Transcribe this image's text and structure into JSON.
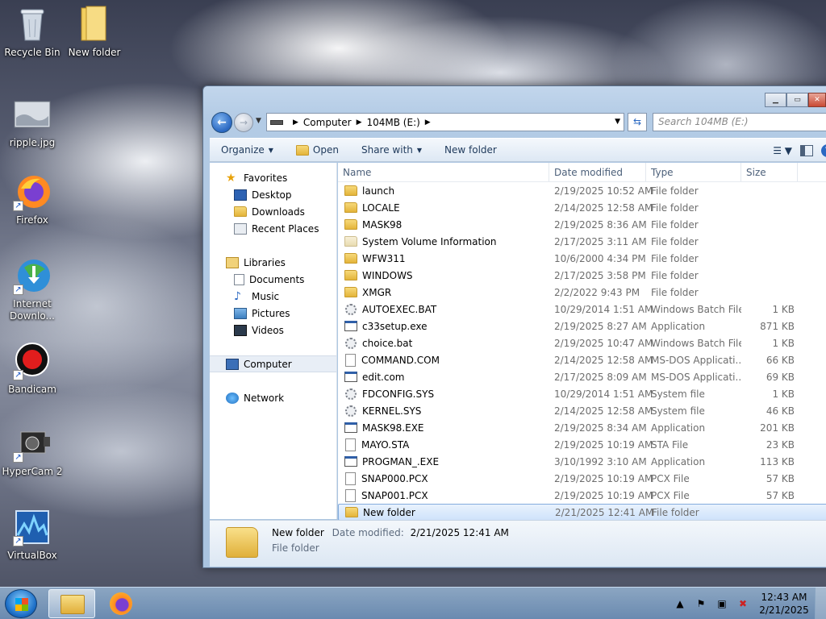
{
  "desktop": {
    "icons": [
      {
        "label": "Recycle Bin"
      },
      {
        "label": "New folder"
      },
      {
        "label": "ripple.jpg"
      },
      {
        "label": "Firefox"
      },
      {
        "label": "Internet Downlo..."
      },
      {
        "label": "Bandicam"
      },
      {
        "label": "HyperCam 2"
      },
      {
        "label": "VirtualBox"
      }
    ]
  },
  "window": {
    "address": {
      "crumbs": [
        "Computer",
        "104MB (E:)"
      ]
    },
    "search_placeholder": "Search 104MB (E:)",
    "toolbar": {
      "organize": "Organize",
      "open": "Open",
      "share_with": "Share with",
      "new_folder": "New folder"
    },
    "nav": {
      "favorites": "Favorites",
      "desktop": "Desktop",
      "downloads": "Downloads",
      "recent_places": "Recent Places",
      "libraries": "Libraries",
      "documents": "Documents",
      "music": "Music",
      "pictures": "Pictures",
      "videos": "Videos",
      "computer": "Computer",
      "network": "Network"
    },
    "columns": {
      "name": "Name",
      "date_modified": "Date modified",
      "type": "Type",
      "size": "Size"
    },
    "files": [
      {
        "name": "launch",
        "date": "2/19/2025 10:52 AM",
        "type": "File folder",
        "size": "",
        "icon": "folder"
      },
      {
        "name": "LOCALE",
        "date": "2/14/2025 12:58 AM",
        "type": "File folder",
        "size": "",
        "icon": "folder"
      },
      {
        "name": "MASK98",
        "date": "2/19/2025 8:36 AM",
        "type": "File folder",
        "size": "",
        "icon": "folder"
      },
      {
        "name": "System Volume Information",
        "date": "2/17/2025 3:11 AM",
        "type": "File folder",
        "size": "",
        "icon": "folder-system"
      },
      {
        "name": "WFW311",
        "date": "10/6/2000 4:34 PM",
        "type": "File folder",
        "size": "",
        "icon": "folder"
      },
      {
        "name": "WINDOWS",
        "date": "2/17/2025 3:58 PM",
        "type": "File folder",
        "size": "",
        "icon": "folder"
      },
      {
        "name": "XMGR",
        "date": "2/2/2022 9:43 PM",
        "type": "File folder",
        "size": "",
        "icon": "folder"
      },
      {
        "name": "AUTOEXEC.BAT",
        "date": "10/29/2014 1:51 AM",
        "type": "Windows Batch File",
        "size": "1 KB",
        "icon": "gear"
      },
      {
        "name": "c33setup.exe",
        "date": "2/19/2025 8:27 AM",
        "type": "Application",
        "size": "871 KB",
        "icon": "app"
      },
      {
        "name": "choice.bat",
        "date": "2/19/2025 10:47 AM",
        "type": "Windows Batch File",
        "size": "1 KB",
        "icon": "gear"
      },
      {
        "name": "COMMAND.COM",
        "date": "2/14/2025 12:58 AM",
        "type": "MS-DOS Applicati...",
        "size": "66 KB",
        "icon": "doc"
      },
      {
        "name": "edit.com",
        "date": "2/17/2025 8:09 AM",
        "type": "MS-DOS Applicati...",
        "size": "69 KB",
        "icon": "app"
      },
      {
        "name": "FDCONFIG.SYS",
        "date": "10/29/2014 1:51 AM",
        "type": "System file",
        "size": "1 KB",
        "icon": "gear"
      },
      {
        "name": "KERNEL.SYS",
        "date": "2/14/2025 12:58 AM",
        "type": "System file",
        "size": "46 KB",
        "icon": "gear"
      },
      {
        "name": "MASK98.EXE",
        "date": "2/19/2025 8:34 AM",
        "type": "Application",
        "size": "201 KB",
        "icon": "app"
      },
      {
        "name": "MAYO.STA",
        "date": "2/19/2025 10:19 AM",
        "type": "STA File",
        "size": "23 KB",
        "icon": "doc"
      },
      {
        "name": "PROGMAN_.EXE",
        "date": "3/10/1992 3:10 AM",
        "type": "Application",
        "size": "113 KB",
        "icon": "app"
      },
      {
        "name": "SNAP000.PCX",
        "date": "2/19/2025 10:19 AM",
        "type": "PCX File",
        "size": "57 KB",
        "icon": "doc"
      },
      {
        "name": "SNAP001.PCX",
        "date": "2/19/2025 10:19 AM",
        "type": "PCX File",
        "size": "57 KB",
        "icon": "doc"
      },
      {
        "name": "New folder",
        "date": "2/21/2025 12:41 AM",
        "type": "File folder",
        "size": "",
        "icon": "folder",
        "selected": true
      }
    ],
    "details": {
      "name": "New folder",
      "date_label": "Date modified:",
      "date_value": "2/21/2025 12:41 AM",
      "type": "File folder"
    }
  },
  "taskbar": {
    "time": "12:43 AM",
    "date": "2/21/2025"
  },
  "colors": {
    "selection_bg": "#cfe3fb",
    "selection_border": "#84acdd",
    "folder": "#e3b43a",
    "toolbar_text": "#1e395b"
  }
}
